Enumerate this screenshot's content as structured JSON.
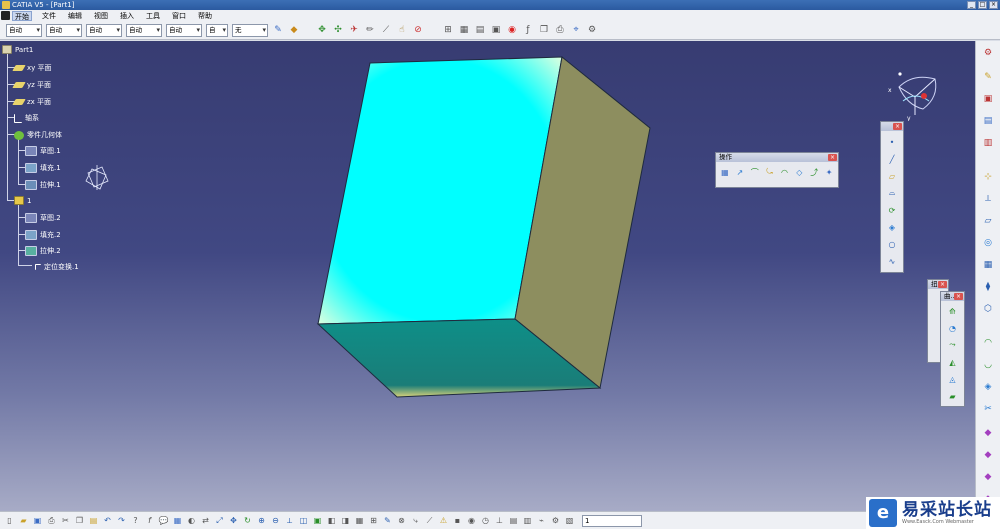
{
  "window": {
    "title": "CATIA V5 - [Part1]"
  },
  "menu": {
    "items": [
      "开始",
      "文件",
      "编辑",
      "视图",
      "插入",
      "工具",
      "窗口",
      "帮助"
    ],
    "active": "开始"
  },
  "toolbar": {
    "combos": [
      {
        "value": "自动"
      },
      {
        "value": "自动"
      },
      {
        "value": "自动"
      },
      {
        "value": "自动"
      },
      {
        "value": "自动"
      },
      {
        "value": "自"
      },
      {
        "value": "无"
      }
    ]
  },
  "tree": {
    "root": "Part1",
    "items": {
      "xy": "xy 平面",
      "yz": "yz 平面",
      "zx": "zx 平面",
      "axis": "轴系",
      "partbody": "零件几何体",
      "sketch1": "草图.1",
      "fill1": "填充.1",
      "extrude1": "拉伸.1",
      "set1": "1",
      "sketch2": "草图.2",
      "fill2": "填充.2",
      "extrude2": "拉伸.2",
      "transform1": "定位变换.1"
    }
  },
  "panels": {
    "operations": {
      "title": "操作"
    },
    "panel_b": {
      "title": ""
    },
    "panel_c": {
      "title": "扭..."
    },
    "panel_d": {
      "title": "曲..."
    }
  },
  "compass": {
    "x": "x",
    "y": "y",
    "z": "z"
  },
  "command": {
    "value": "1"
  },
  "watermark": {
    "title": "易采站长站",
    "subtitle": "Www.Easck.Com  Webmaster"
  },
  "colors": {
    "viewport_top": "#373c72",
    "viewport_bottom": "#a7abc6",
    "face_front": "#00ffff",
    "face_side": "#8d8e5f",
    "face_bottom": "#157f7b"
  }
}
